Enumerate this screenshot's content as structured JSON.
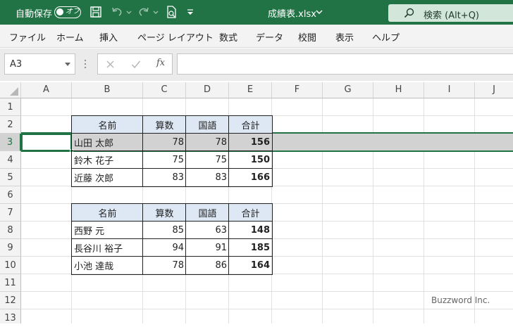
{
  "titlebar": {
    "autosave_label": "自動保存",
    "autosave_state": "オフ",
    "filename": "成績表.xlsx",
    "search_placeholder": "検索 (Alt+Q)"
  },
  "ribbon": {
    "tabs": [
      "ファイル",
      "ホーム",
      "挿入",
      "ページ レイアウト",
      "数式",
      "データ",
      "校閲",
      "表示",
      "ヘルプ"
    ]
  },
  "formula_bar": {
    "name_box": "A3",
    "fx_label": "fx",
    "value": ""
  },
  "grid": {
    "columns": [
      "A",
      "B",
      "C",
      "D",
      "E",
      "F",
      "G",
      "H",
      "I",
      "J"
    ],
    "rows": [
      "1",
      "2",
      "3",
      "4",
      "5",
      "6",
      "7",
      "8",
      "9",
      "10",
      "11",
      "12",
      "13"
    ],
    "selected_row": "3",
    "tables": [
      {
        "headers": [
          "名前",
          "算数",
          "国語",
          "合計"
        ],
        "rows": [
          {
            "name": "山田 太郎",
            "math": "78",
            "japanese": "78",
            "total": "156"
          },
          {
            "name": "鈴木 花子",
            "math": "75",
            "japanese": "75",
            "total": "150"
          },
          {
            "name": "近藤 次郎",
            "math": "83",
            "japanese": "83",
            "total": "166"
          }
        ]
      },
      {
        "headers": [
          "名前",
          "算数",
          "国語",
          "合計"
        ],
        "rows": [
          {
            "name": "西野 元",
            "math": "85",
            "japanese": "63",
            "total": "148"
          },
          {
            "name": "長谷川 裕子",
            "math": "94",
            "japanese": "91",
            "total": "185"
          },
          {
            "name": "小池 達哉",
            "math": "78",
            "japanese": "86",
            "total": "164"
          }
        ]
      }
    ]
  },
  "watermark": "Buzzword Inc.",
  "colors": {
    "excel_green": "#217346",
    "header_fill": "#dde8f4",
    "selection_fill": "#d2d2d2"
  }
}
